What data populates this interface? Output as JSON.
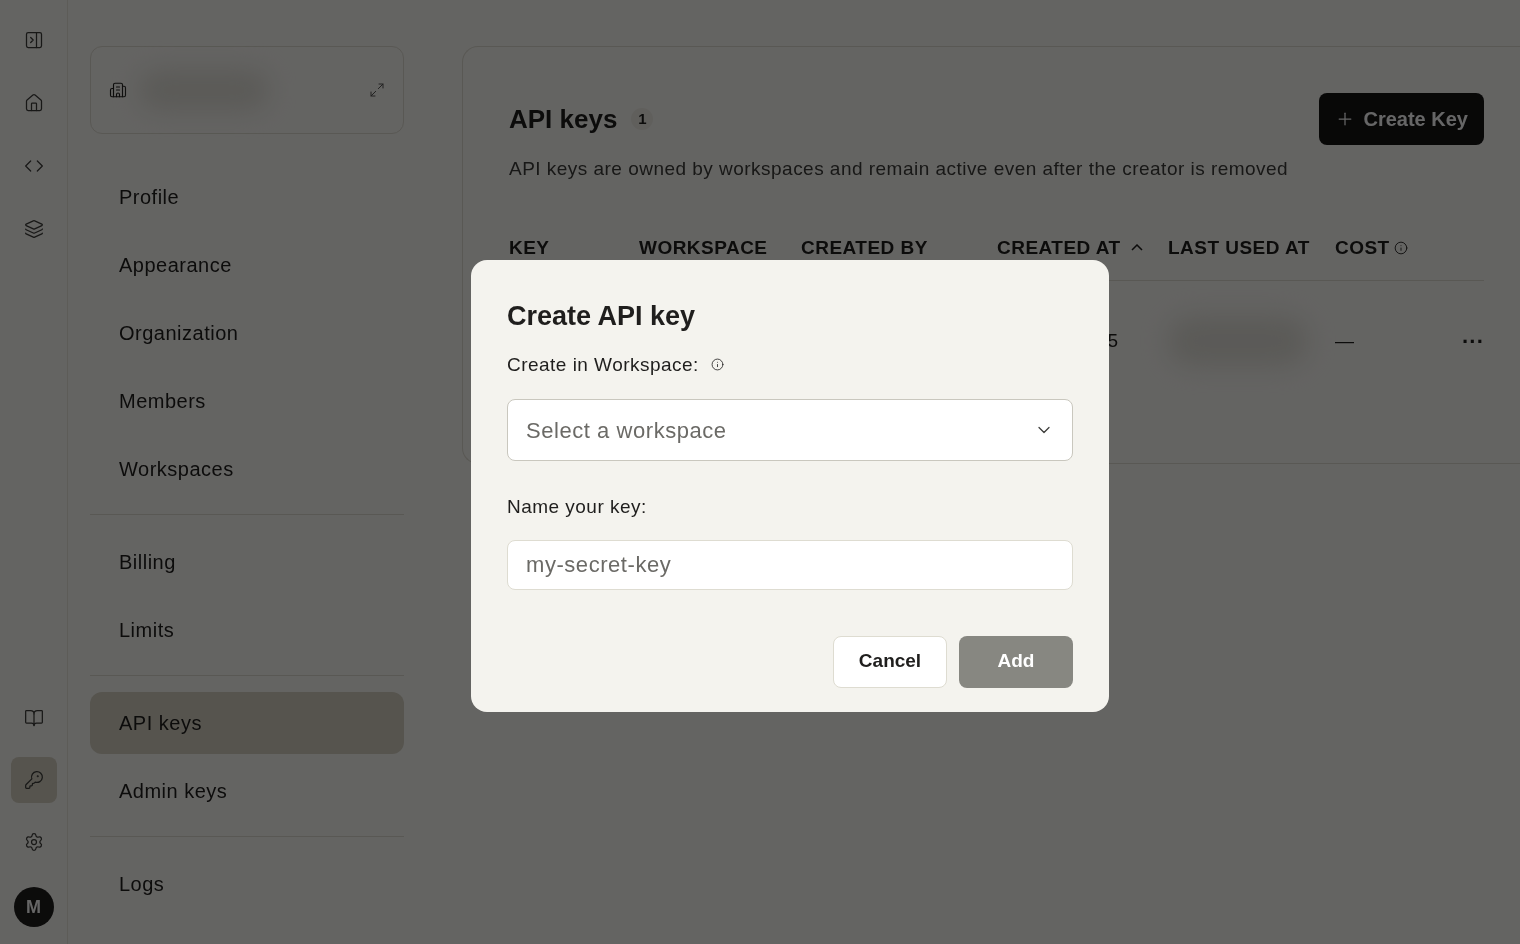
{
  "rail": {
    "top": [
      {
        "kind": "collapse",
        "selected": false
      },
      {
        "kind": "home",
        "selected": false
      },
      {
        "kind": "code",
        "selected": false
      },
      {
        "kind": "layers",
        "selected": false
      }
    ],
    "bottom": [
      {
        "kind": "book",
        "selected": false
      },
      {
        "kind": "key",
        "selected": true
      },
      {
        "kind": "settings",
        "selected": false
      }
    ],
    "avatar": "M"
  },
  "sidebar": {
    "groups": [
      [
        {
          "label": "Profile",
          "selected": false
        },
        {
          "label": "Appearance",
          "selected": false
        },
        {
          "label": "Organization",
          "selected": false
        },
        {
          "label": "Members",
          "selected": false
        },
        {
          "label": "Workspaces",
          "selected": false
        }
      ],
      [
        {
          "label": "Billing",
          "selected": false
        },
        {
          "label": "Limits",
          "selected": false
        }
      ],
      [
        {
          "label": "API keys",
          "selected": true
        },
        {
          "label": "Admin keys",
          "selected": false
        }
      ],
      [
        {
          "label": "Logs",
          "selected": false
        }
      ]
    ]
  },
  "main": {
    "title": "API keys",
    "count": "1",
    "create_button": "Create Key",
    "description": "API keys are owned by workspaces and remain active even after the creator is removed",
    "table": {
      "columns": [
        "KEY",
        "WORKSPACE",
        "CREATED BY",
        "CREATED AT",
        "LAST USED AT",
        "COST"
      ],
      "rows": [
        {
          "created_at": "5",
          "cost": "—",
          "menu": "···"
        }
      ]
    }
  },
  "dialog": {
    "title": "Create API key",
    "workspace_label": "Create in Workspace:",
    "workspace_placeholder": "Select a workspace",
    "name_label": "Name your key:",
    "name_placeholder": "my-secret-key",
    "cancel": "Cancel",
    "add": "Add"
  }
}
